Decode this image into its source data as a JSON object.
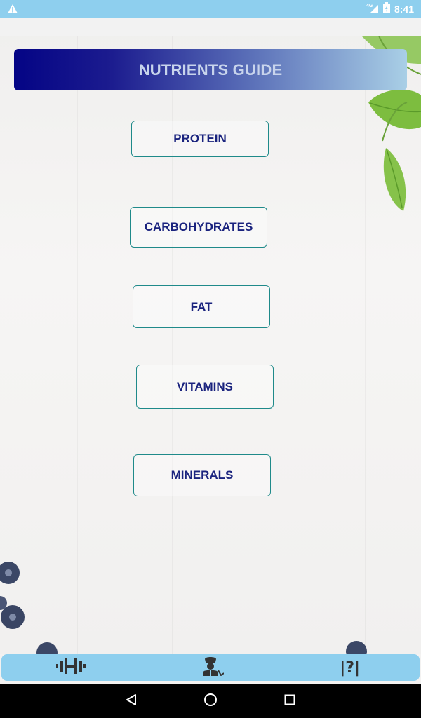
{
  "status_bar": {
    "network": "4G",
    "time": "8:41"
  },
  "header": {
    "title": "NUTRIENTS GUIDE"
  },
  "buttons": [
    {
      "label": "PROTEIN"
    },
    {
      "label": "CARBOHYDRATES"
    },
    {
      "label": "FAT"
    },
    {
      "label": "VITAMINS"
    },
    {
      "label": "MINERALS"
    }
  ],
  "tabbar": {
    "tabs": [
      {
        "icon": "dumbbell-icon"
      },
      {
        "icon": "chef-icon"
      },
      {
        "icon": "help-icon",
        "label": "|?|"
      }
    ]
  },
  "navbar": {
    "buttons": [
      "back-icon",
      "home-icon",
      "recents-icon"
    ]
  },
  "colors": {
    "status_bar": "#8ecfee",
    "header_start": "#040485",
    "header_end": "#a9cfe6",
    "button_text": "#1a237e",
    "button_border": "#1f8a8a"
  }
}
